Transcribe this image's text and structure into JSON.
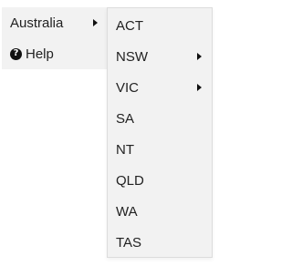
{
  "main_menu": {
    "items": [
      {
        "label": "Australia",
        "icon": "caret-right-icon"
      },
      {
        "label": "Help",
        "icon": "question-circle-icon",
        "icon_glyph": "?"
      }
    ]
  },
  "submenu": {
    "items": [
      {
        "label": "ACT"
      },
      {
        "label": "NSW",
        "icon": "caret-right-icon"
      },
      {
        "label": "VIC",
        "icon": "caret-right-icon"
      },
      {
        "label": "SA"
      },
      {
        "label": "NT"
      },
      {
        "label": "QLD"
      },
      {
        "label": "WA"
      },
      {
        "label": "TAS"
      }
    ]
  },
  "colors": {
    "menu_background": "#f2f2f2",
    "border": "#dcdcdc",
    "text": "#222222"
  }
}
